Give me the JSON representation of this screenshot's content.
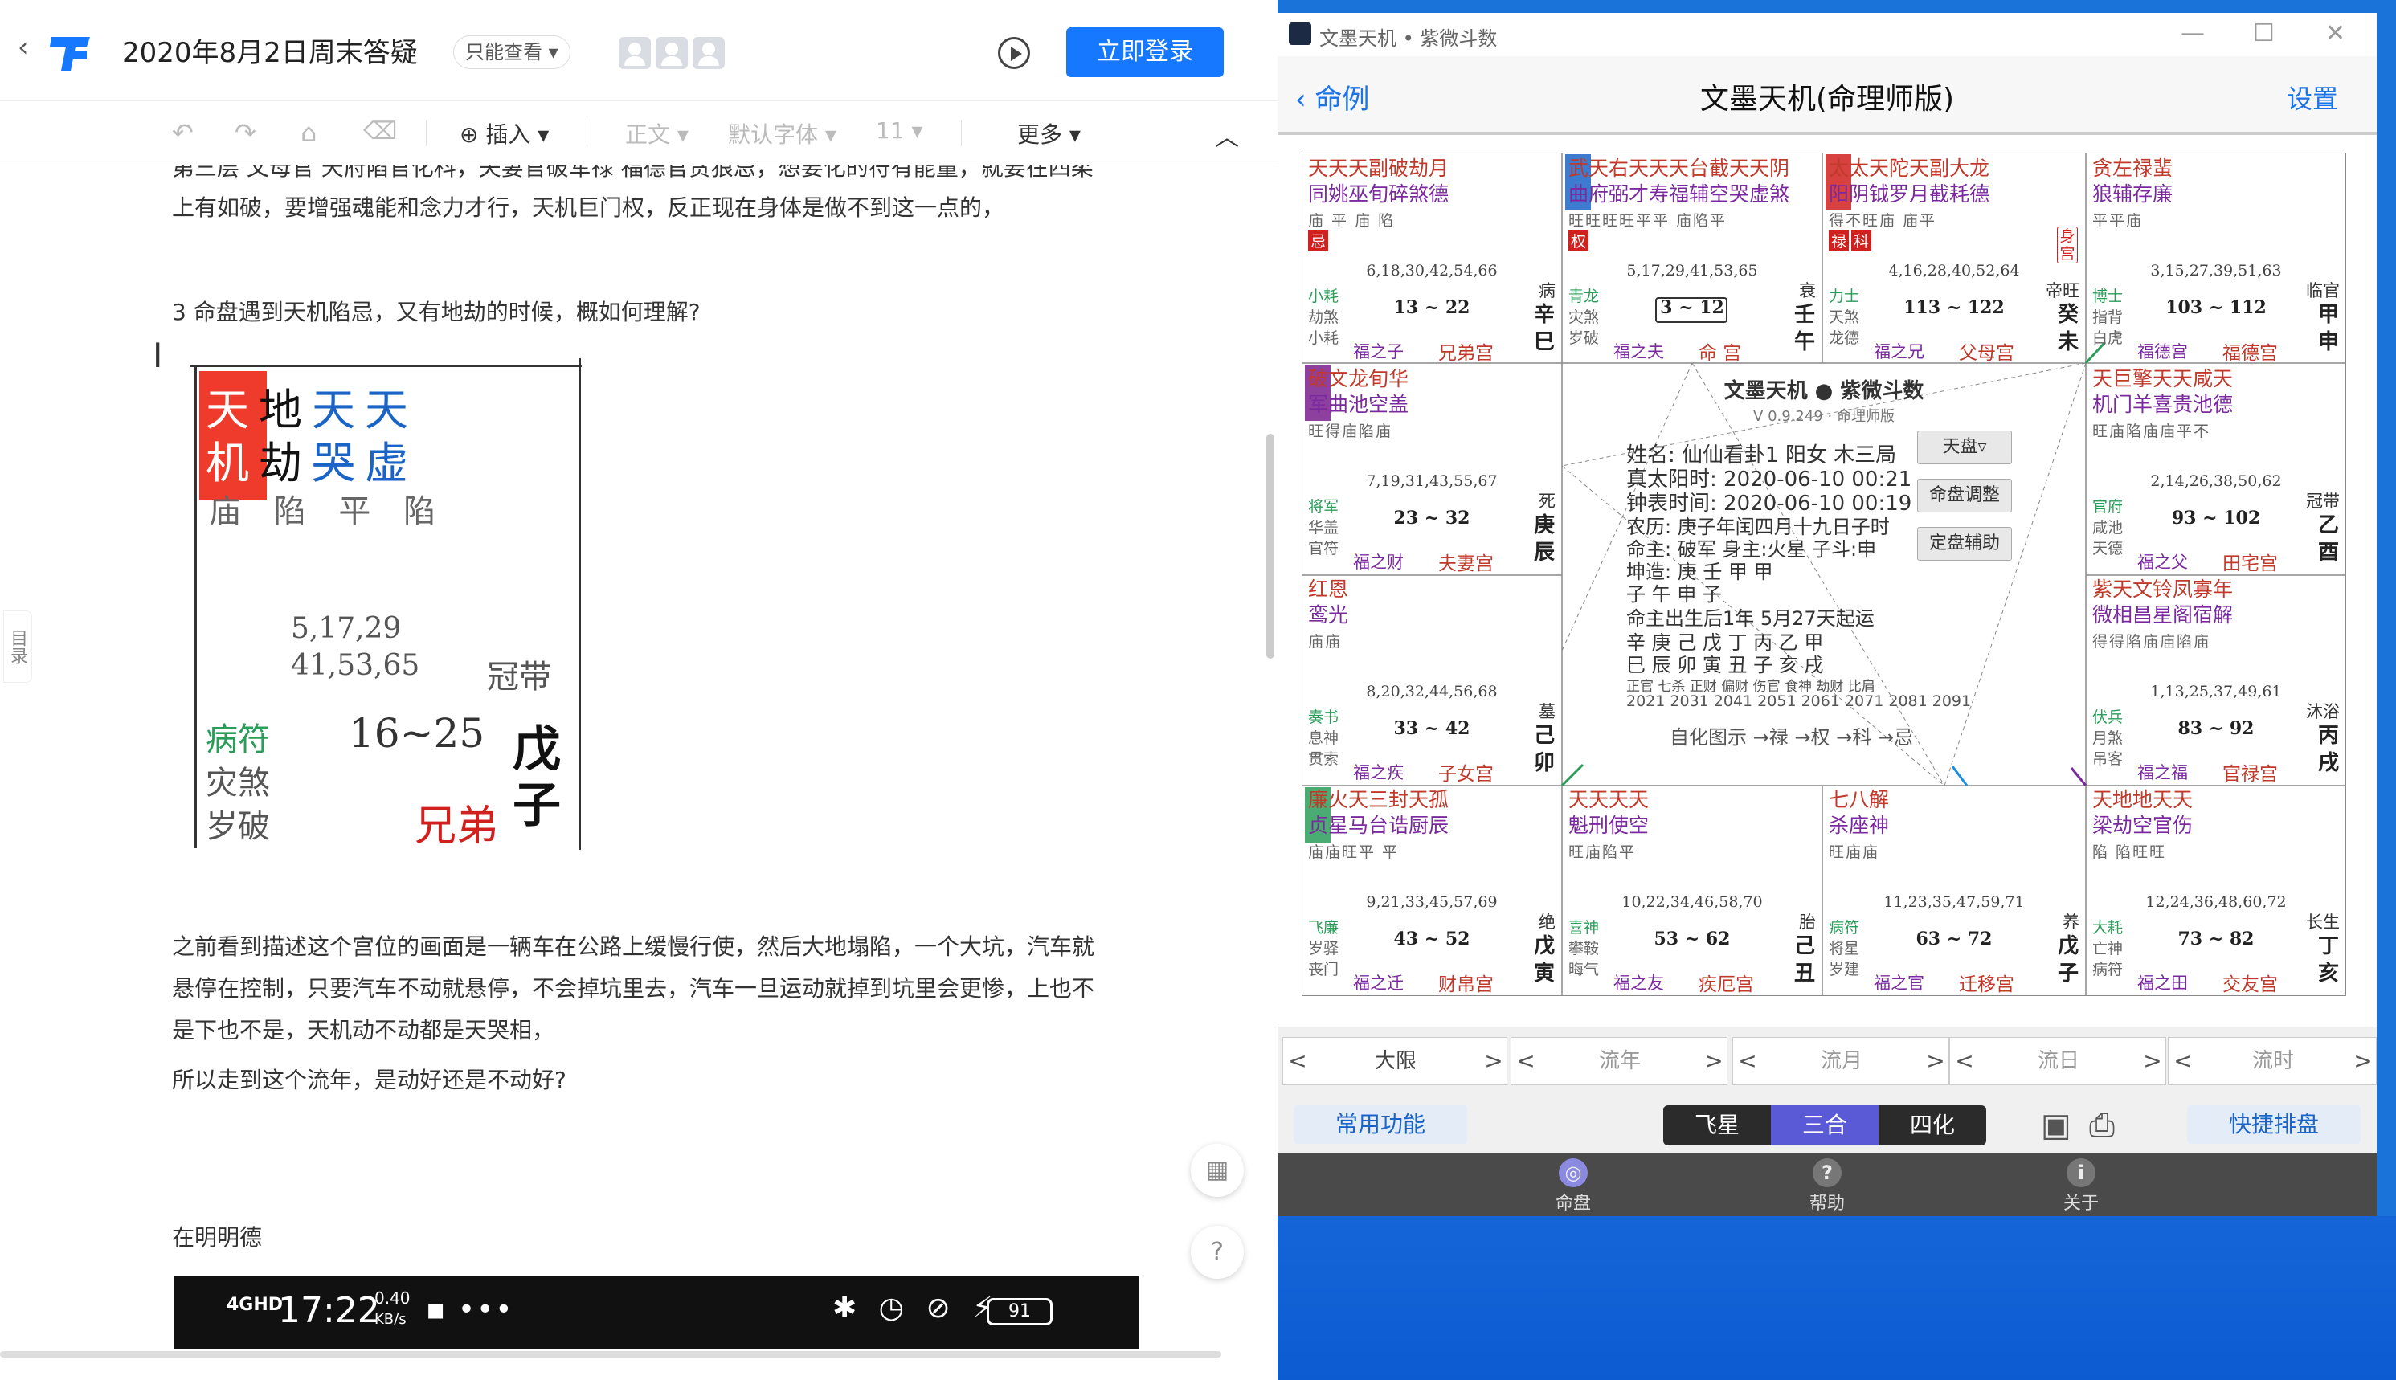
{
  "doc": {
    "title": "2020年8月2日周末答疑",
    "readonly": "只能查看 ▾",
    "login": "立即登录",
    "toolbar": {
      "insert": "⊕ 插入 ▾",
      "style": "正文 ▾",
      "font": "默认字体 ▾",
      "size": "11 ▾",
      "more": "更多 ▾"
    },
    "mulu": "目录",
    "paragraphs": {
      "p0": "第三层 父母官 天府陷官化科，夫妻官破军禄 福德官贪狼忌，想要化的符有能量，就要在四柔",
      "p1": "上有如破，要增强魂能和念力才行，天机巨门权，反正现在身体是做不到这一点的，",
      "p2": "3 命盘遇到天机陷忌，又有地劫的时候，概如何理解?",
      "p3": "之前看到描述这个宫位的画面是一辆车在公路上缓慢行使，然后大地塌陷，一个大坑，汽车就",
      "p4": "悬停在控制，只要汽车不动就悬停，不会掉坑里去，汽车一旦运动就掉到坑里会更惨，上也不",
      "p5": "是下也不是，天机动不动都是天哭相，",
      "p6": "所以走到这个流年，是动好还是不动好?",
      "p7": "在明明德"
    },
    "embed": {
      "s1": "天",
      "s2": "地",
      "s3": "天",
      "s4": "天",
      "s5": "机",
      "s6": "劫",
      "s7": "哭",
      "s8": "虚",
      "lv": "庙 陷 平 陷",
      "n1": "5,17,29",
      "n2": "41,53,65",
      "guan": "冠带",
      "bf": "病符",
      "zs": "灾煞",
      "sp": "岁破",
      "range": "16~25",
      "wu": "戊",
      "zi": "子",
      "xd": "兄弟"
    },
    "phone": {
      "time": "17:22",
      "speed1": "0.40",
      "speed2": "KB/s",
      "net": "4GHD",
      "batt": "91"
    },
    "float_qr": "▦",
    "float_help": "?"
  },
  "app": {
    "window_title": "文墨天机 • 紫微斗数",
    "back": "命例",
    "title": "文墨天机(命理师版)",
    "settings": "设置",
    "center": {
      "name": "文墨天机 ● 紫微斗数",
      "ver": "V 0.9.249 · 命理师版",
      "l1": "姓名: 仙仙看卦1   阳女 木三局",
      "l2": "真太阳时: 2020-06-10 00:21",
      "l3": "钟表时间: 2020-06-10 00:19",
      "l4": "农历: 庚子年闰四月十九日子时",
      "l5": "命主: 破军 身主:火星 子斗:申",
      "l6": "坤造:  庚     壬     甲     甲",
      "l7": "         子     午     申     子",
      "l8": "命主出生后1年 5月27天起运",
      "l9": "   辛   庚   己   戊   丁   丙   乙   甲",
      "l10": "   巳   辰   卯   寅   丑   子   亥   戌",
      "l11": "正官 七杀 正财 偏财 伤官 食神 劫财 比肩",
      "l12": "2021 2031 2041 2051 2061 2071 2081 2091",
      "l13": "自化图示 →禄 →权 →科 →忌",
      "btn1": "天盘▿",
      "btn2": "命盘调整",
      "btn3": "定盘辅助"
    },
    "palaces": [
      {
        "stars": "天天天副破劫月",
        "stars2": "同姚巫旬碎煞德",
        "lv": "庙 平    庙 陷",
        "years": "6,18,30,42,54,66",
        "range": "13 ~ 22",
        "g1": "辛",
        "g2": "巳",
        "st": "病",
        "m1": "小耗",
        "m2": "劫煞",
        "m3": "小耗",
        "fz": "福之子",
        "name": "兄弟宫"
      },
      {
        "stars": "武天右天天天台截天天阴",
        "stars2": "曲府弼才寿福辅空哭虚煞",
        "lv": "旺旺旺旺平平    庙陷平",
        "years": "5,17,29,41,53,65",
        "range": "3 ~ 12",
        "g1": "壬",
        "g2": "午",
        "st": "衰",
        "m1": "青龙",
        "m2": "灾煞",
        "m3": "岁破",
        "fz": "福之夫",
        "name": "命 宫"
      },
      {
        "stars": "太太天陀天副大龙",
        "stars2": "阳阴钺罗月截耗德",
        "lv": "得不旺庙    庙平",
        "years": "4,16,28,40,52,64",
        "range": "113 ~ 122",
        "g1": "癸",
        "g2": "未",
        "st": "帝旺",
        "m1": "力士",
        "m2": "天煞",
        "m3": "龙德",
        "fz": "福之兄",
        "name": "父母宫"
      },
      {
        "stars": "贪左禄蜚",
        "stars2": "狼辅存廉",
        "lv": "平平庙",
        "years": "3,15,27,39,51,63",
        "range": "103 ~ 112",
        "g1": "甲",
        "g2": "申",
        "st": "临官",
        "m1": "博士",
        "m2": "指背",
        "m3": "白虎",
        "fz": "福德宫",
        "name": "福德宫"
      },
      {
        "stars": "破文龙旬华",
        "stars2": "军曲池空盖",
        "lv": "旺得庙陷庙",
        "years": "7,19,31,43,55,67",
        "range": "23 ~ 32",
        "g1": "庚",
        "g2": "辰",
        "st": "死",
        "m1": "将军",
        "m2": "华盖",
        "m3": "官符",
        "fz": "福之财",
        "name": "夫妻宫"
      },
      {
        "stars": "天巨擎天天咸天",
        "stars2": "机门羊喜贵池德",
        "lv": "旺庙陷庙庙平不",
        "years": "2,14,26,38,50,62",
        "range": "93 ~ 102",
        "g1": "乙",
        "g2": "酉",
        "st": "冠带",
        "m1": "官府",
        "m2": "咸池",
        "m3": "天德",
        "fz": "福之父",
        "name": "田宅宫"
      },
      {
        "stars": "红恩",
        "stars2": "鸾光",
        "lv": "庙庙",
        "years": "8,20,32,44,56,68",
        "range": "33 ~ 42",
        "g1": "己",
        "g2": "卯",
        "st": "墓",
        "m1": "奏书",
        "m2": "息神",
        "m3": "贯索",
        "fz": "福之疾",
        "name": "子女宫"
      },
      {
        "stars": "紫天文铃凤寡年",
        "stars2": "微相昌星阁宿解",
        "lv": "得得陷庙庙陷庙",
        "years": "1,13,25,37,49,61",
        "range": "83 ~ 92",
        "g1": "丙",
        "g2": "戌",
        "st": "沐浴",
        "m1": "伏兵",
        "m2": "月煞",
        "m3": "吊客",
        "fz": "福之福",
        "name": "官禄宫"
      },
      {
        "stars": "廉火天三封天孤",
        "stars2": "贞星马台诰厨辰",
        "lv": "庙庙旺平    平",
        "years": "9,21,33,45,57,69",
        "range": "43 ~ 52",
        "g1": "戊",
        "g2": "寅",
        "st": "绝",
        "m1": "飞廉",
        "m2": "岁驿",
        "m3": "丧门",
        "fz": "福之迁",
        "name": "财帛宫"
      },
      {
        "stars": "天天天天",
        "stars2": "魁刑使空",
        "lv": "旺庙陷平",
        "years": "10,22,34,46,58,70",
        "range": "53 ~ 62",
        "g1": "己",
        "g2": "丑",
        "st": "胎",
        "m1": "喜神",
        "m2": "攀鞍",
        "m3": "晦气",
        "fz": "福之友",
        "name": "疾厄宫"
      },
      {
        "stars": "七八解",
        "stars2": "杀座神",
        "lv": "旺庙庙",
        "years": "11,23,35,47,59,71",
        "range": "63 ~ 72",
        "g1": "戊",
        "g2": "子",
        "st": "养",
        "m1": "病符",
        "m2": "将星",
        "m3": "岁建",
        "fz": "福之官",
        "name": "迁移宫"
      },
      {
        "stars": "天地地天天",
        "stars2": "梁劫空官伤",
        "lv": "陷    陷旺旺",
        "years": "12,24,36,48,60,72",
        "range": "73 ~ 82",
        "g1": "丁",
        "g2": "亥",
        "st": "长生",
        "m1": "大耗",
        "m2": "亡神",
        "m3": "病符",
        "fz": "福之田",
        "name": "交友宫"
      }
    ],
    "ctl": {
      "daxian": "大限",
      "liunian": "流年",
      "liuyue": "流月",
      "liuri": "流日",
      "liushi": "流时"
    },
    "func": {
      "common": "常用功能",
      "fei": "飞星",
      "san": "三合",
      "si": "四化",
      "quick": "快捷排盘"
    },
    "tabs": {
      "t1": "命盘",
      "t2": "帮助",
      "t3": "关于"
    },
    "shen": "身宫",
    "quan": "权",
    "lu": "禄",
    "ke": "科",
    "ji": "忌"
  }
}
